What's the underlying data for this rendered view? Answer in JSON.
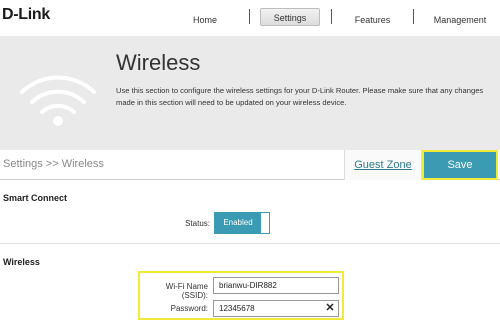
{
  "brand": {
    "logo_text": "D-Link"
  },
  "nav": {
    "items": [
      {
        "label": "Home"
      },
      {
        "label": "Settings",
        "active": true
      },
      {
        "label": "Features"
      },
      {
        "label": "Management"
      }
    ]
  },
  "banner": {
    "icon": "wifi-icon",
    "title": "Wireless",
    "description": "Use this section to configure the wireless settings for your D-Link Router. Please make sure that any changes made in this section will need to be updated on your wireless device."
  },
  "toolbar": {
    "breadcrumb": "Settings >> Wireless",
    "guest_zone_label": "Guest Zone",
    "save_label": "Save"
  },
  "smart_connect": {
    "title": "Smart Connect",
    "status_label": "Status:",
    "status_value": "Enabled"
  },
  "wireless": {
    "title": "Wireless",
    "ssid_label": "Wi-Fi Name (SSID):",
    "ssid_value": "brianwu-DIR882",
    "password_label": "Password:",
    "password_value": "12345678",
    "clear_icon": "close-icon"
  },
  "colors": {
    "accent": "#3a9bb2",
    "highlight": "#f2ea3a",
    "banner_bg": "#eaeaea"
  }
}
